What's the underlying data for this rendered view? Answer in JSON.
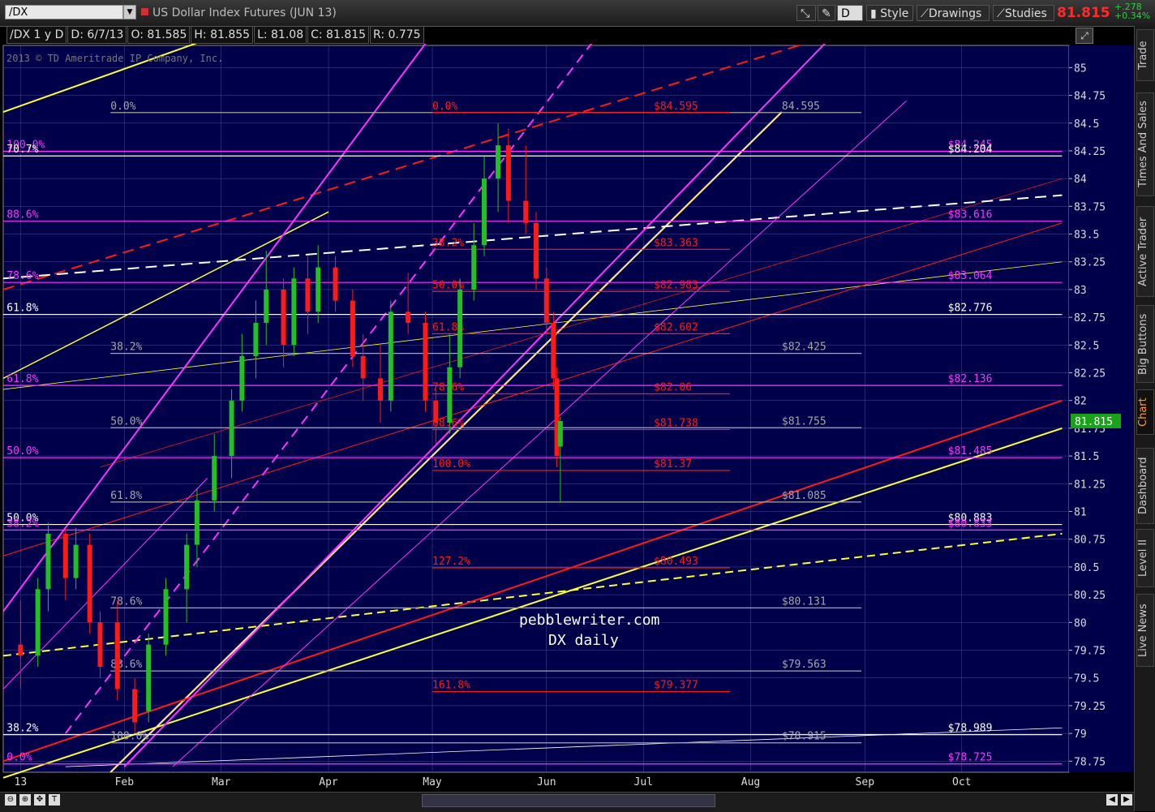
{
  "header": {
    "symbol": "/DX",
    "title": "US Dollar Index Futures (JUN 13)",
    "buttons": [
      "D",
      "Style",
      "Drawings",
      "Studies"
    ],
    "last_price": "81.815",
    "change": "+.278",
    "change_pct": "+0.34%"
  },
  "info_bar": [
    "/DX 1 y D",
    "D: 6/7/13",
    "O: 81.585",
    "H: 81.855",
    "L: 81.08",
    "C: 81.815",
    "R: 0.775"
  ],
  "copyright": "2013 © TD Ameritrade IP Company, Inc.",
  "sidebar_tabs": [
    "Trade",
    "Times And Sales",
    "Active Trader",
    "Big Buttons",
    "Chart",
    "Dashboard",
    "Level II",
    "Live News"
  ],
  "watermark": [
    "pebblewriter.com",
    "DX daily"
  ],
  "colors": {
    "background": "#00004a",
    "grid": "#4a4a9a",
    "up": "#22c022",
    "down": "#ff1a1a",
    "yellow": "#ffff33",
    "magenta": "#ff33ff",
    "red": "#ff1a1a",
    "white": "#ffffff",
    "gray": "#a0a0a0"
  },
  "chart_data": {
    "type": "candlestick",
    "instrument": "/DX",
    "timeframe": "1 y D",
    "ylim": [
      78.65,
      85.2
    ],
    "y_ticks": [
      "85",
      "84.75",
      "84.5",
      "84.25",
      "84",
      "83.75",
      "83.5",
      "83.25",
      "83",
      "82.75",
      "82.5",
      "82.25",
      "82",
      "81.75",
      "81.5",
      "81.25",
      "81",
      "80.75",
      "80.5",
      "80.25",
      "80",
      "79.75",
      "79.5",
      "79.25",
      "79",
      "78.75"
    ],
    "x_ticks": [
      "13",
      "Feb",
      "Mar",
      "Apr",
      "May",
      "Jun",
      "Jul",
      "Aug",
      "Sep",
      "Oct"
    ],
    "x_tick_dates": [
      "2013-01-02",
      "2013-02-01",
      "2013-03-01",
      "2013-04-01",
      "2013-05-01",
      "2013-06-03",
      "2013-07-01",
      "2013-08-01",
      "2013-09-03",
      "2013-10-01"
    ],
    "last_price_label": "81.815",
    "candles_approx": [
      {
        "date": "2013-01-02",
        "o": 79.8,
        "h": 80.2,
        "l": 79.4,
        "c": 79.7
      },
      {
        "date": "2013-01-07",
        "o": 79.7,
        "h": 80.4,
        "l": 79.6,
        "c": 80.3
      },
      {
        "date": "2013-01-10",
        "o": 80.3,
        "h": 80.9,
        "l": 80.1,
        "c": 80.8
      },
      {
        "date": "2013-01-15",
        "o": 80.8,
        "h": 80.85,
        "l": 80.2,
        "c": 80.4
      },
      {
        "date": "2013-01-18",
        "o": 80.4,
        "h": 80.85,
        "l": 80.3,
        "c": 80.7
      },
      {
        "date": "2013-01-22",
        "o": 80.7,
        "h": 80.8,
        "l": 79.9,
        "c": 80.0
      },
      {
        "date": "2013-01-25",
        "o": 80.0,
        "h": 80.1,
        "l": 79.5,
        "c": 79.6
      },
      {
        "date": "2013-01-30",
        "o": 80.0,
        "h": 80.2,
        "l": 79.3,
        "c": 79.4
      },
      {
        "date": "2013-02-04",
        "o": 79.4,
        "h": 79.5,
        "l": 79.0,
        "c": 79.1
      },
      {
        "date": "2013-02-08",
        "o": 79.2,
        "h": 79.9,
        "l": 79.1,
        "c": 79.8
      },
      {
        "date": "2013-02-13",
        "o": 79.8,
        "h": 80.4,
        "l": 79.7,
        "c": 80.3
      },
      {
        "date": "2013-02-19",
        "o": 80.3,
        "h": 80.8,
        "l": 80.0,
        "c": 80.7
      },
      {
        "date": "2013-02-22",
        "o": 80.7,
        "h": 81.2,
        "l": 80.5,
        "c": 81.1
      },
      {
        "date": "2013-02-27",
        "o": 81.1,
        "h": 81.7,
        "l": 81.0,
        "c": 81.5
      },
      {
        "date": "2013-03-04",
        "o": 81.5,
        "h": 82.1,
        "l": 81.3,
        "c": 82.0
      },
      {
        "date": "2013-03-07",
        "o": 82.0,
        "h": 82.6,
        "l": 81.9,
        "c": 82.4
      },
      {
        "date": "2013-03-11",
        "o": 82.4,
        "h": 82.9,
        "l": 82.2,
        "c": 82.7
      },
      {
        "date": "2013-03-14",
        "o": 82.7,
        "h": 83.35,
        "l": 82.5,
        "c": 83.0
      },
      {
        "date": "2013-03-19",
        "o": 83.0,
        "h": 83.1,
        "l": 82.3,
        "c": 82.5
      },
      {
        "date": "2013-03-22",
        "o": 82.5,
        "h": 83.2,
        "l": 82.4,
        "c": 83.1
      },
      {
        "date": "2013-03-26",
        "o": 83.1,
        "h": 83.3,
        "l": 82.6,
        "c": 82.8
      },
      {
        "date": "2013-03-29",
        "o": 82.8,
        "h": 83.4,
        "l": 82.7,
        "c": 83.2
      },
      {
        "date": "2013-04-03",
        "o": 83.2,
        "h": 83.3,
        "l": 82.8,
        "c": 82.9
      },
      {
        "date": "2013-04-08",
        "o": 82.9,
        "h": 83.0,
        "l": 82.3,
        "c": 82.4
      },
      {
        "date": "2013-04-11",
        "o": 82.4,
        "h": 82.6,
        "l": 82.0,
        "c": 82.2
      },
      {
        "date": "2013-04-16",
        "o": 82.2,
        "h": 82.5,
        "l": 81.8,
        "c": 82.0
      },
      {
        "date": "2013-04-19",
        "o": 82.0,
        "h": 82.9,
        "l": 81.9,
        "c": 82.8
      },
      {
        "date": "2013-04-24",
        "o": 82.8,
        "h": 83.15,
        "l": 82.6,
        "c": 82.7
      },
      {
        "date": "2013-04-29",
        "o": 82.7,
        "h": 82.8,
        "l": 81.9,
        "c": 82.0
      },
      {
        "date": "2013-05-02",
        "o": 82.0,
        "h": 82.1,
        "l": 81.6,
        "c": 81.8
      },
      {
        "date": "2013-05-06",
        "o": 81.8,
        "h": 82.6,
        "l": 81.7,
        "c": 82.3
      },
      {
        "date": "2013-05-09",
        "o": 82.3,
        "h": 83.1,
        "l": 82.2,
        "c": 83.0
      },
      {
        "date": "2013-05-13",
        "o": 83.0,
        "h": 83.6,
        "l": 82.9,
        "c": 83.4
      },
      {
        "date": "2013-05-16",
        "o": 83.4,
        "h": 84.2,
        "l": 83.3,
        "c": 84.0
      },
      {
        "date": "2013-05-20",
        "o": 84.0,
        "h": 84.5,
        "l": 83.7,
        "c": 84.3
      },
      {
        "date": "2013-05-23",
        "o": 84.3,
        "h": 84.45,
        "l": 83.6,
        "c": 83.8
      },
      {
        "date": "2013-05-28",
        "o": 83.8,
        "h": 84.3,
        "l": 83.5,
        "c": 83.6
      },
      {
        "date": "2013-05-31",
        "o": 83.6,
        "h": 83.7,
        "l": 83.0,
        "c": 83.1
      },
      {
        "date": "2013-06-03",
        "o": 83.1,
        "h": 83.2,
        "l": 82.6,
        "c": 82.7
      },
      {
        "date": "2013-06-05",
        "o": 82.7,
        "h": 82.8,
        "l": 82.1,
        "c": 82.2
      },
      {
        "date": "2013-06-06",
        "o": 82.2,
        "h": 82.3,
        "l": 81.4,
        "c": 81.5
      },
      {
        "date": "2013-06-07",
        "o": 81.585,
        "h": 81.855,
        "l": 81.08,
        "c": 81.815
      }
    ],
    "horizontal_levels": [
      {
        "value": 84.595,
        "color": "gray",
        "label_left": "0.0%",
        "label_right": "84.595"
      },
      {
        "value": 84.595,
        "color": "red",
        "label_left": "0.0%",
        "label_right": "$84.595"
      },
      {
        "value": 84.245,
        "color": "magenta",
        "label_left": "100.0%",
        "label_right": "$84.245"
      },
      {
        "value": 84.204,
        "color": "white",
        "label_left": "70.7%",
        "label_right": "$84.204"
      },
      {
        "value": 83.616,
        "color": "magenta",
        "label_left": "88.6%",
        "label_right": "$83.616"
      },
      {
        "value": 83.363,
        "color": "red",
        "label_left": "38.2%",
        "label_right": "$83.363"
      },
      {
        "value": 83.064,
        "color": "magenta",
        "label_left": "78.6%",
        "label_right": "$83.064"
      },
      {
        "value": 82.983,
        "color": "red",
        "label_left": "50.0%",
        "label_right": "$82.983"
      },
      {
        "value": 82.776,
        "color": "white",
        "label_left": "61.8%",
        "label_right": "$82.776"
      },
      {
        "value": 82.602,
        "color": "red",
        "label_left": "61.8%",
        "label_right": "$82.602"
      },
      {
        "value": 82.425,
        "color": "gray",
        "label_left": "38.2%",
        "label_right": "$82.425"
      },
      {
        "value": 82.136,
        "color": "magenta",
        "label_left": "61.8%",
        "label_right": "$82.136"
      },
      {
        "value": 82.06,
        "color": "red",
        "label_left": "78.6%",
        "label_right": "$82.06"
      },
      {
        "value": 81.755,
        "color": "gray",
        "label_left": "50.0%",
        "label_right": "$81.755"
      },
      {
        "value": 81.738,
        "color": "red",
        "label_left": "88.6%",
        "label_right": "$81.738"
      },
      {
        "value": 81.485,
        "color": "magenta",
        "label_left": "50.0%",
        "label_right": "$81.485"
      },
      {
        "value": 81.37,
        "color": "red",
        "label_left": "100.0%",
        "label_right": "$81.37"
      },
      {
        "value": 81.085,
        "color": "gray",
        "label_left": "61.8%",
        "label_right": "$81.085"
      },
      {
        "value": 80.883,
        "color": "white",
        "label_left": "50.0%",
        "label_right": "$80.883"
      },
      {
        "value": 80.833,
        "color": "magenta",
        "label_left": "38.2%",
        "label_right": "$80.833"
      },
      {
        "value": 80.493,
        "color": "red",
        "label_left": "127.2%",
        "label_right": "$80.493"
      },
      {
        "value": 80.131,
        "color": "gray",
        "label_left": "78.6%",
        "label_right": "$80.131"
      },
      {
        "value": 79.563,
        "color": "gray",
        "label_left": "88.6%",
        "label_right": "$79.563"
      },
      {
        "value": 79.377,
        "color": "red",
        "label_left": "161.8%",
        "label_right": "$79.377"
      },
      {
        "value": 78.989,
        "color": "white",
        "label_left": "38.2%",
        "label_right": "$78.989"
      },
      {
        "value": 78.915,
        "color": "gray",
        "label_left": "100.0%",
        "label_right": "$78.915"
      },
      {
        "value": 78.725,
        "color": "magenta",
        "label_left": "0.0%",
        "label_right": "$78.725"
      }
    ]
  }
}
